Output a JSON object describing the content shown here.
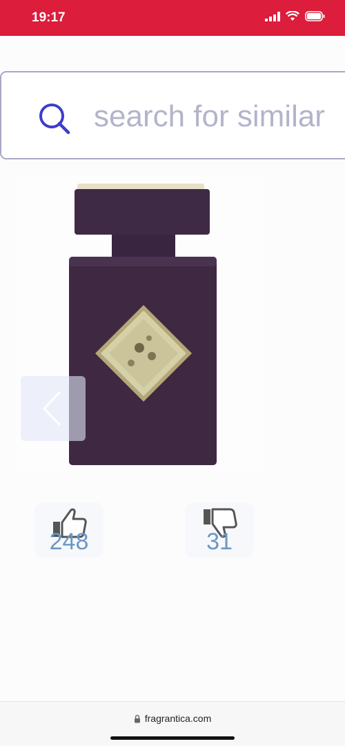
{
  "status_bar": {
    "time": "19:17",
    "signal_icon": "cellular-signal-icon",
    "wifi_icon": "wifi-icon",
    "battery_icon": "battery-icon",
    "color": "#dc1d3b"
  },
  "search": {
    "placeholder": "search for similar",
    "icon": "search-icon",
    "icon_color": "#3d3ec9"
  },
  "product": {
    "image": "perfume-bottle",
    "colors": {
      "bottle": "#3e2842",
      "emblem": "#c9c39a"
    }
  },
  "carousel": {
    "prev_icon": "chevron-left-icon"
  },
  "votes": {
    "like_icon": "thumbs-up-icon",
    "like_count": "248",
    "dislike_icon": "thumbs-down-icon",
    "dislike_count": "31",
    "count_color": "#6b97c5"
  },
  "browser": {
    "lock_icon": "lock-icon",
    "url": "fragrantica.com"
  }
}
